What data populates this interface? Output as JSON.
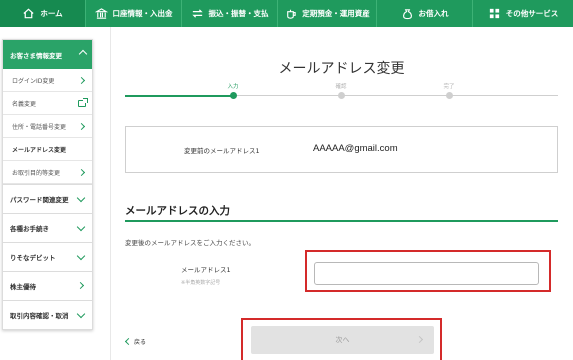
{
  "topnav": [
    {
      "label": "ホーム",
      "icon": "home-icon"
    },
    {
      "label": "口座情報・入出金",
      "icon": "bank-icon"
    },
    {
      "label": "振込・振替・支払",
      "icon": "transfer-icon"
    },
    {
      "label": "定期預金・運用資産",
      "icon": "teapot-icon"
    },
    {
      "label": "お借入れ",
      "icon": "coin-bag-icon"
    },
    {
      "label": "その他サービス",
      "icon": "grid-icon"
    }
  ],
  "sidebar": {
    "header": "お客さま情報変更",
    "sub_items": [
      {
        "label": "ログインID変更",
        "icon": "chevron-right-icon"
      },
      {
        "label": "名義変更",
        "icon": "external-link-icon"
      },
      {
        "label": "住所・電話番号変更",
        "icon": "chevron-right-icon"
      },
      {
        "label": "メールアドレス変更",
        "icon": "none"
      },
      {
        "label": "お取引目的等変更",
        "icon": "chevron-right-icon"
      }
    ],
    "main_items": [
      {
        "label": "パスワード関連変更",
        "icon": "chevron-down-icon"
      },
      {
        "label": "各種お手続き",
        "icon": "chevron-down-icon"
      },
      {
        "label": "りそなデビット",
        "icon": "chevron-down-icon"
      },
      {
        "label": "株主優待",
        "icon": "chevron-right-icon"
      },
      {
        "label": "取引内容確認・取消",
        "icon": "chevron-down-icon"
      }
    ]
  },
  "main": {
    "title": "メールアドレス変更",
    "steps": [
      "入力",
      "確認",
      "完了"
    ],
    "current_step": 0,
    "current_email_label": "変更前のメールアドレス1",
    "current_email": "AAAAA@gmail.com",
    "section_title": "メールアドレスの入力",
    "instruction": "変更後のメールアドレスをご入力ください。",
    "field_label": "メールアドレス1",
    "field_note": "※半角英数字記号",
    "email_value": "",
    "back_label": "戻る",
    "next_label": "次へ"
  },
  "colors": {
    "brand": "#1f9a5d",
    "highlight": "#d42a2a"
  }
}
